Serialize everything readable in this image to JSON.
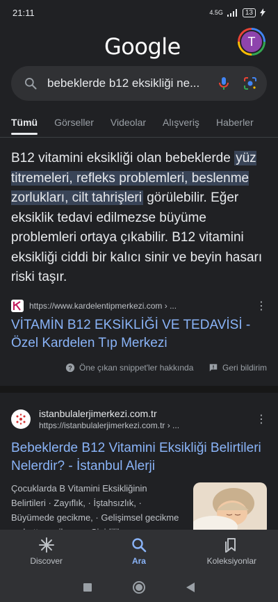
{
  "status": {
    "time": "21:11",
    "network": "4.5G",
    "battery": "13"
  },
  "header": {
    "logo": "Google",
    "avatar_letter": "T"
  },
  "search": {
    "query": "bebeklerde b12 eksikliği ne..."
  },
  "tabs": [
    "Tümü",
    "Görseller",
    "Videolar",
    "Alışveriş",
    "Haberler"
  ],
  "featured": {
    "text_before": "B12 vitamini eksikliği olan bebeklerde ",
    "highlight": "yüz titremeleri, refleks problemleri, beslenme zorlukları, cilt tahrişleri",
    "text_after": " görülebilir. Eğer eksiklik tedavi edilmezse büyüme problemleri ortaya çıkabilir. B12 vitamini eksikliği ciddi bir kalıcı sinir ve beyin hasarı riski taşır.",
    "source_url": "https://www.kardelentipmerkezi.com › ...",
    "title": "VİTAMİN B12 EKSİKLİĞİ VE TEDAVİSİ - Özel Kardelen Tıp Merkezi",
    "about_label": "Öne çıkan snippet'ler hakkında",
    "feedback_label": "Geri bildirim"
  },
  "result2": {
    "site_name": "istanbulalerjimerkezi.com.tr",
    "url": "https://istanbulalerjimerkezi.com.tr › ...",
    "title": "Bebeklerde B12 Vitamini Eksikliği Belirtileri Nelerdir? - İstanbul Alerji",
    "description": "Çocuklarda B Vitamini Eksikliğinin Belirtileri · Zayıflık, · İştahsızlık, · Büyümede gecikme, · Gelişimsel gecikme ve hatta gerileme, · Sinirlilik"
  },
  "bottom_nav": {
    "discover": "Discover",
    "search": "Ara",
    "collections": "Koleksiyonlar"
  }
}
